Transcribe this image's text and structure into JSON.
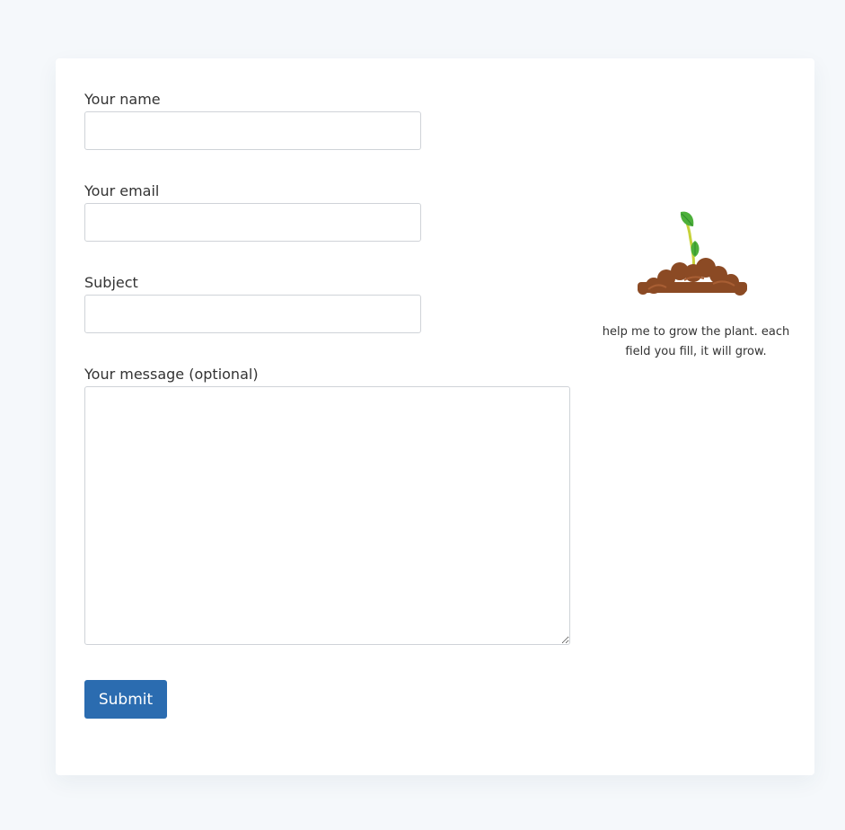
{
  "form": {
    "name_label": "Your name",
    "name_value": "",
    "email_label": "Your email",
    "email_value": "",
    "subject_label": "Subject",
    "subject_value": "",
    "message_label": "Your message (optional)",
    "message_value": "",
    "submit_label": "Submit"
  },
  "plant": {
    "icon": "sprout-in-soil-icon",
    "caption": "help me to grow the plant. each field you fill, it will grow."
  },
  "colors": {
    "page_background": "#f5f8fb",
    "card_background": "#ffffff",
    "accent": "#2b6cb0",
    "soil": "#8b4a24",
    "leaf": "#4caf3a"
  }
}
